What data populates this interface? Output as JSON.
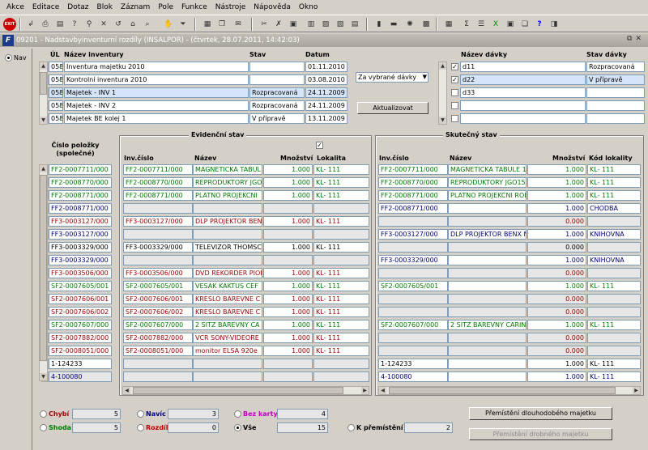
{
  "menu": [
    "Akce",
    "Editace",
    "Dotaz",
    "Blok",
    "Záznam",
    "Pole",
    "Funkce",
    "Nástroje",
    "Nápověda",
    "Okno"
  ],
  "window": {
    "title": "09201 - Nadstavbyinventurní rozdíly (INSALPOR) - (čtvrtek, 28.07.2011, 14:42:03)",
    "logo": "F"
  },
  "nav": {
    "label": "Nav"
  },
  "headers": {
    "ul": "ÚL",
    "nazev_inventury": "Název inventury",
    "stav": "Stav",
    "datum": "Datum",
    "nazev_davky": "Název dávky",
    "stav_davky": "Stav dávky",
    "cislo_polozky": "Číslo položky (společné)",
    "inv_cislo": "Inv.číslo",
    "nazev": "Název",
    "mnozstvi": "Množství",
    "lokalita": "Lokalita",
    "kod_lokality": "Kód lokality"
  },
  "groups": {
    "evid": "Evidenční stav",
    "skut": "Skutečný stav"
  },
  "inventory": [
    {
      "ul": "058",
      "name": "Inventura majetku 2010",
      "stav": "",
      "datum": "01.11.2010"
    },
    {
      "ul": "058",
      "name": "Kontrolní inventura 2010",
      "stav": "",
      "datum": "03.08.2010"
    },
    {
      "ul": "058",
      "name": "Majetek - INV 1",
      "stav": "Rozpracovaná",
      "datum": "24.11.2009"
    },
    {
      "ul": "058",
      "name": "Majetek - INV 2",
      "stav": "Rozpracovaná",
      "datum": "24.11.2009"
    },
    {
      "ul": "058",
      "name": "Majetek BE kolej 1",
      "stav": "V přípravě",
      "datum": "13.11.2009"
    }
  ],
  "dropdown": {
    "value": "Za vybrané dávky"
  },
  "buttons": {
    "aktualizovat": "Aktualizovat",
    "dlouhodoby": "Přemístění dlouhodobého majetku",
    "drobny": "Přemístění drobného majetku"
  },
  "batches": [
    {
      "checked": true,
      "name": "d11",
      "stav": "Rozpracovaná"
    },
    {
      "checked": true,
      "name": "d22",
      "stav": "V přípravě"
    },
    {
      "checked": false,
      "name": "d33",
      "stav": ""
    },
    {
      "checked": false,
      "name": "",
      "stav": ""
    },
    {
      "checked": false,
      "name": "",
      "stav": ""
    }
  ],
  "items": [
    {
      "code": "FF2-0007711/000",
      "c": "green",
      "e_inv": "FF2-0007711/000",
      "e_name": "MAGNETICKA TABUL",
      "e_qty": "1.000",
      "e_lok": "KL- 111",
      "s_inv": "FF2-0007711/000",
      "s_name": "MAGNETICKA TABULE 1",
      "s_qty": "1.000",
      "s_kod": "KL- 111"
    },
    {
      "code": "FF2-0008770/000",
      "c": "green",
      "e_inv": "FF2-0008770/000",
      "e_name": "REPRODUKTORY JGO",
      "e_qty": "1.000",
      "e_lok": "KL- 111",
      "s_inv": "FF2-0008770/000",
      "s_name": "REPRODUKTORY JGO15",
      "s_qty": "1.000",
      "s_kod": "KL- 111"
    },
    {
      "code": "FF2-0008771/000",
      "c": "green",
      "e_inv": "FF2-0008771/000",
      "e_name": "PLATNO PROJEKCNI",
      "e_qty": "1.000",
      "e_lok": "KL- 111",
      "s_inv": "FF2-0008771/000",
      "s_name": "PLATNO PROJEKCNI ROL",
      "s_qty": "1.000",
      "s_kod": "KL- 111"
    },
    {
      "code": "FF2-0008771/000",
      "c": "blue",
      "e_inv": "",
      "e_name": "",
      "e_qty": "",
      "e_lok": "",
      "s_inv": "FF2-0008771/000",
      "s_name": "",
      "s_qty": "1.000",
      "s_kod": "CHODBA"
    },
    {
      "code": "FF3-0003127/000",
      "c": "red",
      "e_inv": "FF3-0003127/000",
      "e_name": "DLP PROJEKTOR BEN",
      "e_qty": "1.000",
      "e_lok": "KL- 111",
      "s_inv": "",
      "s_name": "",
      "s_qty": "0.000",
      "s_kod": ""
    },
    {
      "code": "FF3-0003127/000",
      "c": "blue",
      "e_inv": "",
      "e_name": "",
      "e_qty": "",
      "e_lok": "",
      "s_inv": "FF3-0003127/000",
      "s_name": "DLP PROJEKTOR BENX M",
      "s_qty": "1.000",
      "s_kod": "KNIHOVNA"
    },
    {
      "code": "FF3-0003329/000",
      "c": "",
      "e_inv": "FF3-0003329/000",
      "e_name": "TELEVIZOR THOMSC",
      "e_qty": "1.000",
      "e_lok": "KL- 111",
      "s_inv": "",
      "s_name": "",
      "s_qty": "0.000",
      "s_kod": ""
    },
    {
      "code": "FF3-0003329/000",
      "c": "blue",
      "e_inv": "",
      "e_name": "",
      "e_qty": "",
      "e_lok": "",
      "s_inv": "FF3-0003329/000",
      "s_name": "",
      "s_qty": "1.000",
      "s_kod": "KNIHOVNA"
    },
    {
      "code": "FF3-0003506/000",
      "c": "red",
      "e_inv": "FF3-0003506/000",
      "e_name": "DVD REKORDER PIOI",
      "e_qty": "1.000",
      "e_lok": "KL- 111",
      "s_inv": "",
      "s_name": "",
      "s_qty": "0.000",
      "s_kod": ""
    },
    {
      "code": "SF2-0007605/001",
      "c": "green",
      "e_inv": "SF2-0007605/001",
      "e_name": "VESAK KAKTUS CEF",
      "e_qty": "1.000",
      "e_lok": "KL- 111",
      "s_inv": "SF2-0007605/001",
      "s_name": "",
      "s_qty": "1.000",
      "s_kod": "KL- 111"
    },
    {
      "code": "SF2-0007606/001",
      "c": "red",
      "e_inv": "SF2-0007606/001",
      "e_name": "KRESLO BAREVNE C",
      "e_qty": "1.000",
      "e_lok": "KL- 111",
      "s_inv": "",
      "s_name": "",
      "s_qty": "0.000",
      "s_kod": ""
    },
    {
      "code": "SF2-0007606/002",
      "c": "red",
      "e_inv": "SF2-0007606/002",
      "e_name": "KRESLO BAREVNE C",
      "e_qty": "1.000",
      "e_lok": "KL- 111",
      "s_inv": "",
      "s_name": "",
      "s_qty": "0.000",
      "s_kod": ""
    },
    {
      "code": "SF2-0007607/000",
      "c": "green",
      "e_inv": "SF2-0007607/000",
      "e_name": "2 SITZ BAREVNY CA",
      "e_qty": "1.000",
      "e_lok": "KL- 111",
      "s_inv": "SF2-0007607/000",
      "s_name": "2 SITZ BAREVNY CARIN",
      "s_qty": "1.000",
      "s_kod": "KL- 111"
    },
    {
      "code": "SF2-0007882/000",
      "c": "red",
      "e_inv": "SF2-0007882/000",
      "e_name": "VCR SONY-VIDEORE",
      "e_qty": "1.000",
      "e_lok": "KL- 111",
      "s_inv": "",
      "s_name": "",
      "s_qty": "0.000",
      "s_kod": ""
    },
    {
      "code": "SF2-0008051/000",
      "c": "red",
      "e_inv": "SF2-0008051/000",
      "e_name": "monitor ELSA 920e",
      "e_qty": "1.000",
      "e_lok": "KL- 111",
      "s_inv": "",
      "s_name": "",
      "s_qty": "0.000",
      "s_kod": ""
    },
    {
      "code": "1-124233",
      "c": "",
      "e_inv": "",
      "e_name": "",
      "e_qty": "",
      "e_lok": "",
      "s_inv": "1-124233",
      "s_name": "",
      "s_qty": "1.000",
      "s_kod": "KL- 111"
    },
    {
      "code": "4-100080",
      "c": "blue",
      "e_inv": "",
      "e_name": "",
      "e_qty": "",
      "e_lok": "",
      "s_inv": "4-100080",
      "s_name": "",
      "s_qty": "1.000",
      "s_kod": "KL- 111"
    }
  ],
  "evid_checkbox": "✓",
  "summary": {
    "chybi": {
      "label": "Chybí",
      "value": "5"
    },
    "shoda": {
      "label": "Shoda",
      "value": "5"
    },
    "navic": {
      "label": "Navíc",
      "value": "3"
    },
    "rozdil": {
      "label": "Rozdíl",
      "value": "0"
    },
    "bez_karty": {
      "label": "Bez karty",
      "value": "4"
    },
    "vse": {
      "label": "Vše",
      "value": "15"
    },
    "k_premisteni": {
      "label": "K přemístění",
      "value": "2"
    }
  },
  "colors": {
    "green": "#007a00",
    "red": "#9a0000",
    "blue": "#00007a",
    "magenta": "#c000c0"
  }
}
